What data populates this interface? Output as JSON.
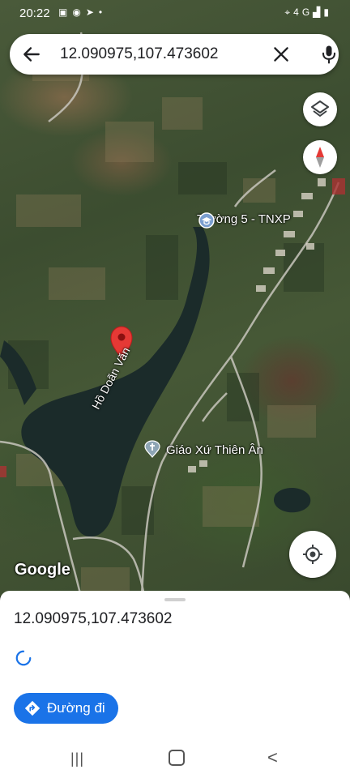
{
  "status_bar": {
    "time": "20:22",
    "left_icons": [
      "image-icon",
      "messenger-icon",
      "send-icon",
      "dot-icon"
    ],
    "right_icons": [
      "location-icon",
      "4g-icon",
      "signal-icon",
      "battery-icon"
    ],
    "right_text": "4G"
  },
  "search": {
    "query": "12.090975,107.473602",
    "back_icon": "arrow-back-icon",
    "clear_icon": "close-icon",
    "mic_icon": "mic-icon"
  },
  "map": {
    "places": [
      {
        "name": "Trường 5 - TNXP",
        "icon": "school-icon"
      },
      {
        "name": "Giáo Xứ Thiên Ân",
        "icon": "church-icon"
      }
    ],
    "lake_label": "Hồ Doãn Văn",
    "attribution": "Google",
    "pin_color": "#e53935",
    "water_color": "#1b2b2a"
  },
  "controls": {
    "layers_icon": "layers-icon",
    "compass_icon": "compass-icon",
    "locate_icon": "my-location-icon"
  },
  "sheet": {
    "coordinates": "12.090975,107.473602",
    "directions_label": "Đường đi",
    "accent": "#1a73e8"
  },
  "navbar": {
    "recent_glyph": "|||",
    "back_glyph": "<"
  }
}
